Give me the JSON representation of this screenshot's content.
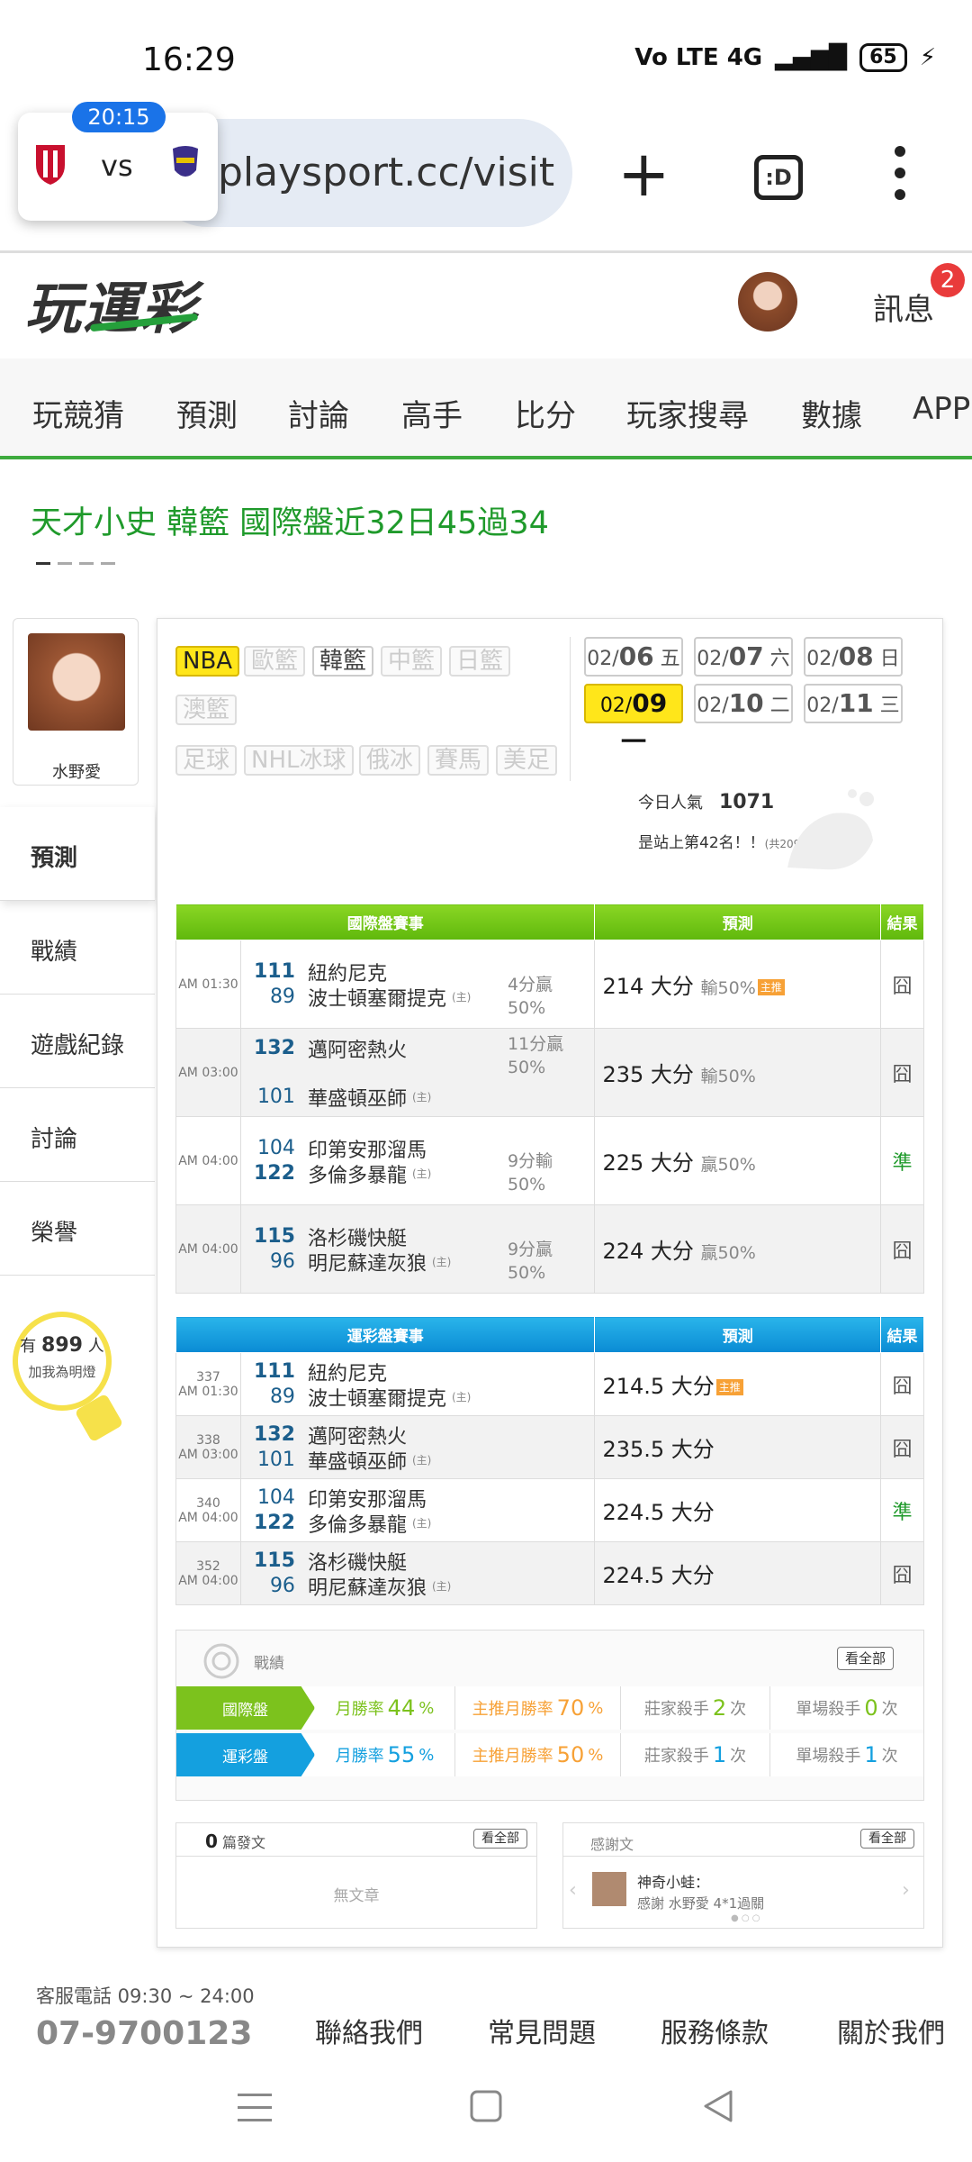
{
  "status_bar": {
    "time": "16:29",
    "network": "Vo LTE 4G",
    "battery": "65"
  },
  "browser": {
    "url": "playsport.cc/visit",
    "tab_count": ":D",
    "score_popup": {
      "timer": "20:15",
      "vs": "vs"
    }
  },
  "site": {
    "logo": "玩運彩",
    "messages_label": "訊息",
    "messages_badge": "2"
  },
  "nav": {
    "items": [
      "玩競猜",
      "預測",
      "討論",
      "高手",
      "比分",
      "玩家搜尋",
      "數據",
      "APP"
    ]
  },
  "headline": "天才小史 韓籃 國際盤近32日45過34",
  "profile": {
    "name": "水野愛"
  },
  "side_menu": [
    "預測",
    "戰績",
    "遊戲紀錄",
    "討論",
    "榮譽"
  ],
  "bulb": {
    "prefix": "有",
    "count": "899",
    "suffix": "人",
    "sub": "加我為明燈"
  },
  "leagues": {
    "row1": [
      "NBA",
      "歐籃",
      "韓籃",
      "中籃",
      "日籃"
    ],
    "row2": [
      "澳籃"
    ],
    "row3": [
      "足球",
      "NHL冰球",
      "俄冰",
      "賽馬",
      "美足"
    ]
  },
  "dates": [
    {
      "md": "02/",
      "d": "06",
      "w": "五"
    },
    {
      "md": "02/",
      "d": "07",
      "w": "六"
    },
    {
      "md": "02/",
      "d": "08",
      "w": "日"
    },
    {
      "md": "02/",
      "d": "09",
      "w": "一"
    },
    {
      "md": "02/",
      "d": "10",
      "w": "二"
    },
    {
      "md": "02/",
      "d": "11",
      "w": "三"
    }
  ],
  "popularity": {
    "label": "今日人氣",
    "value": "1071",
    "rank": "昰站上第42名！！",
    "rank_note": "(共20999人)"
  },
  "intl_table": {
    "headers": [
      "國際盤賽事",
      "預測",
      "結果"
    ],
    "rows": [
      {
        "time": "AM 01:30",
        "s1": "111",
        "t1": "紐約尼克",
        "s2": "89",
        "t2": "波士頓塞爾提克",
        "home": "(主)",
        "hc1": "4分贏",
        "hc2": "50%",
        "pick": "214 大分",
        "rate": "輸50%",
        "tag": "主推",
        "result": "囧"
      },
      {
        "time": "AM 03:00",
        "s1": "132",
        "t1": "邁阿密熱火",
        "s2": "101",
        "t2": "華盛頓巫師",
        "home": "(主)",
        "hc1": "11分贏",
        "hc2": "50%",
        "pick": "235 大分",
        "rate": "輸50%",
        "tag": "",
        "result": "囧"
      },
      {
        "time": "AM 04:00",
        "s1": "104",
        "t1": "印第安那溜馬",
        "s2": "122",
        "t2": "多倫多暴龍",
        "home": "(主)",
        "hc1": "9分輸",
        "hc2": "50%",
        "pick": "225 大分",
        "rate": "贏50%",
        "tag": "",
        "result": "準"
      },
      {
        "time": "AM 04:00",
        "s1": "115",
        "t1": "洛杉磯快艇",
        "s2": "96",
        "t2": "明尼蘇達灰狼",
        "home": "(主)",
        "hc1": "9分贏",
        "hc2": "50%",
        "pick": "224 大分",
        "rate": "贏50%",
        "tag": "",
        "result": "囧"
      }
    ]
  },
  "lottery_table": {
    "headers": [
      "運彩盤賽事",
      "預測",
      "結果"
    ],
    "rows": [
      {
        "no": "337",
        "time": "AM 01:30",
        "s1": "111",
        "t1": "紐約尼克",
        "s2": "89",
        "t2": "波士頓塞爾提克",
        "home": "(主)",
        "pick": "214.5 大分",
        "tag": "主推",
        "result": "囧"
      },
      {
        "no": "338",
        "time": "AM 03:00",
        "s1": "132",
        "t1": "邁阿密熱火",
        "s2": "101",
        "t2": "華盛頓巫師",
        "home": "(主)",
        "pick": "235.5 大分",
        "tag": "",
        "result": "囧"
      },
      {
        "no": "340",
        "time": "AM 04:00",
        "s1": "104",
        "t1": "印第安那溜馬",
        "s2": "122",
        "t2": "多倫多暴龍",
        "home": "(主)",
        "pick": "224.5 大分",
        "tag": "",
        "result": "準"
      },
      {
        "no": "352",
        "time": "AM 04:00",
        "s1": "115",
        "t1": "洛杉磯快艇",
        "s2": "96",
        "t2": "明尼蘇達灰狼",
        "home": "(主)",
        "pick": "224.5 大分",
        "tag": "",
        "result": "囧"
      }
    ]
  },
  "stats": {
    "title": "戰績",
    "see_all": "看全部",
    "rows": [
      {
        "label": "國際盤",
        "m_lab": "月勝率",
        "m_val": "44",
        "pm_lab": "主推月勝率",
        "pm_val": "70",
        "pct": "%",
        "dk_lab": "莊家殺手",
        "dk_val": "2",
        "sk_lab": "單場殺手",
        "sk_val": "0",
        "unit": "次"
      },
      {
        "label": "運彩盤",
        "m_lab": "月勝率",
        "m_val": "55",
        "pm_lab": "主推月勝率",
        "pm_val": "50",
        "pct": "%",
        "dk_lab": "莊家殺手",
        "dk_val": "1",
        "sk_lab": "單場殺手",
        "sk_val": "1",
        "unit": "次"
      }
    ]
  },
  "posts": {
    "count": "0",
    "label": "篇發文",
    "see_all": "看全部",
    "empty": "無文章"
  },
  "thanks": {
    "title": "感謝文",
    "see_all": "看全部",
    "user": "神奇小蛙：",
    "text": "感謝 水野愛 4*1過關"
  },
  "footer": {
    "hotline": "客服電話 09:30 ~ 24:00",
    "phone": "07-9700123",
    "links": [
      "聯絡我們",
      "常見問題",
      "服務條款",
      "關於我們"
    ]
  }
}
